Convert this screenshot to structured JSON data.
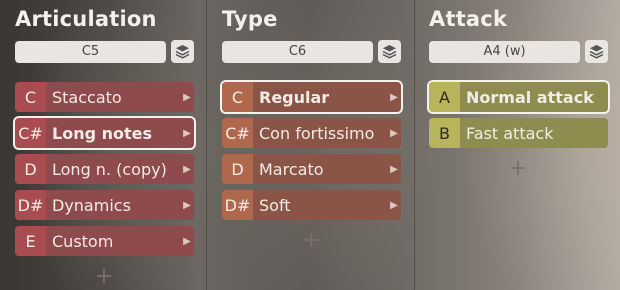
{
  "colors": {
    "articulation_key": "#a84c52",
    "articulation_body": "#8e4a4c",
    "type_key": "#b0684c",
    "type_body": "#8a5446",
    "attack_key": "#b8b45c",
    "attack_body": "#8e8c4e"
  },
  "panels": [
    {
      "title": "Articulation",
      "key_value": "C5",
      "items": [
        {
          "key": "C",
          "label": "Staccato"
        },
        {
          "key": "C#",
          "label": "Long notes"
        },
        {
          "key": "D",
          "label": "Long n. (copy)"
        },
        {
          "key": "D#",
          "label": "Dynamics"
        },
        {
          "key": "E",
          "label": "Custom"
        }
      ]
    },
    {
      "title": "Type",
      "key_value": "C6",
      "items": [
        {
          "key": "C",
          "label": "Regular"
        },
        {
          "key": "C#",
          "label": "Con fortissimo"
        },
        {
          "key": "D",
          "label": "Marcato"
        },
        {
          "key": "D#",
          "label": "Soft"
        }
      ]
    },
    {
      "title": "Attack",
      "key_value": "A4 (w)",
      "items": [
        {
          "key": "A",
          "label": "Normal attack"
        },
        {
          "key": "B",
          "label": "Fast attack"
        }
      ]
    }
  ]
}
